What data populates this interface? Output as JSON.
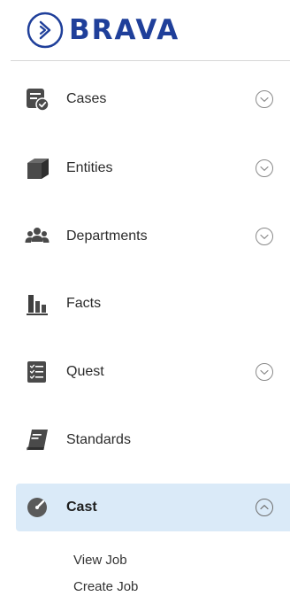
{
  "brand": {
    "name": "BRAVA",
    "color": "#1f3f9a"
  },
  "nav": {
    "items": [
      {
        "label": "Cases",
        "icon": "cases-icon",
        "expandable": true,
        "expanded": false
      },
      {
        "label": "Entities",
        "icon": "cube-icon",
        "expandable": true,
        "expanded": false
      },
      {
        "label": "Departments",
        "icon": "users-group-icon",
        "expandable": true,
        "expanded": false
      },
      {
        "label": "Facts",
        "icon": "bar-chart-icon",
        "expandable": false
      },
      {
        "label": "Quest",
        "icon": "checklist-icon",
        "expandable": true,
        "expanded": false
      },
      {
        "label": "Standards",
        "icon": "book-icon",
        "expandable": false
      },
      {
        "label": "Cast",
        "icon": "gauge-icon",
        "expandable": true,
        "expanded": true,
        "active": true
      }
    ],
    "cast_subitems": [
      {
        "label": "View Job"
      },
      {
        "label": "Create Job"
      }
    ]
  },
  "colors": {
    "active_background": "#daeaf8",
    "icon": "#4a4a4a",
    "chevron": "#8a8a8a"
  }
}
